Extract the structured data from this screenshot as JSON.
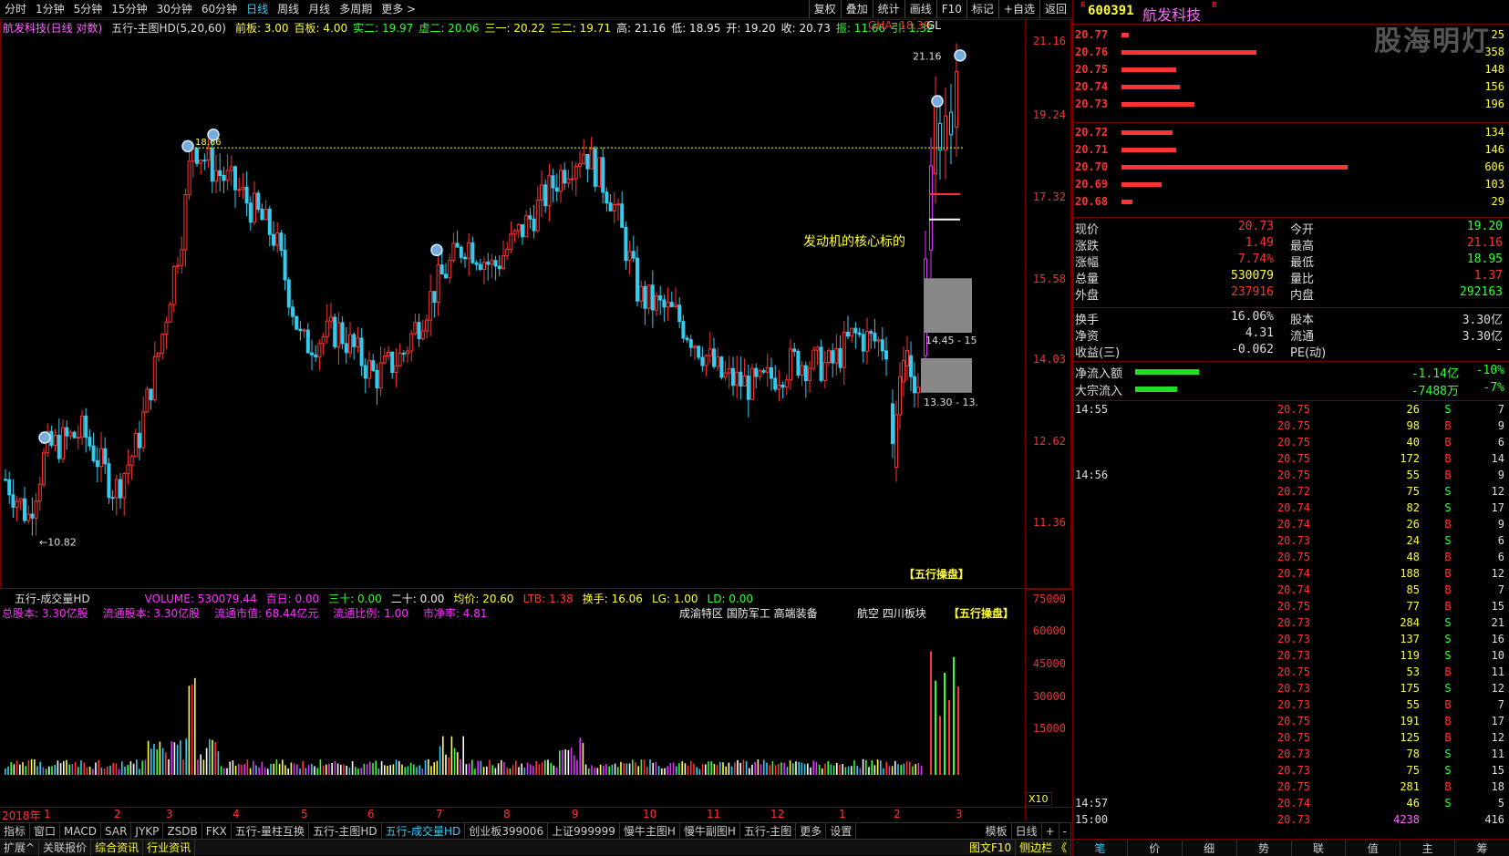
{
  "toolbar": {
    "periods": [
      "分时",
      "1分钟",
      "5分钟",
      "15分钟",
      "30分钟",
      "60分钟",
      "日线",
      "周线",
      "月线",
      "多周期",
      "更多 >"
    ],
    "active": "日线",
    "right_buttons": [
      "复权",
      "叠加",
      "统计",
      "画线",
      "F10",
      "标记",
      "+自选",
      "返回"
    ]
  },
  "main_info": {
    "name": "航发科技",
    "mode": "(日线 对数)",
    "indicator": "五行-主图HD(5,20,60)",
    "items": [
      {
        "k": "前板:",
        "v": "3.00",
        "c": "#ff3"
      },
      {
        "k": "百板:",
        "v": "4.00",
        "c": "#ff3"
      },
      {
        "k": "实二:",
        "v": "19.97",
        "c": "#3f3"
      },
      {
        "k": "虚二:",
        "v": "20.06",
        "c": "#3f3"
      },
      {
        "k": "三一:",
        "v": "20.22",
        "c": "#ff3"
      },
      {
        "k": "三二:",
        "v": "19.71",
        "c": "#ff3"
      },
      {
        "k": "高:",
        "v": "21.16",
        "c": "#eee"
      },
      {
        "k": "低:",
        "v": "18.95",
        "c": "#eee"
      },
      {
        "k": "开:",
        "v": "19.20",
        "c": "#eee"
      },
      {
        "k": "收:",
        "v": "20.73",
        "c": "#eee"
      },
      {
        "k": "振:",
        "v": "11.66",
        "c": "#3f3"
      },
      {
        "k": "引:",
        "v": "1.32",
        "c": "#3f3"
      }
    ],
    "gha": "GHA: 18.39",
    "gl": "GL"
  },
  "price_axis": [
    "21.16",
    "19.24",
    "17.32",
    "15.58",
    "14.03",
    "12.62",
    "11.36"
  ],
  "chart_labels": {
    "high_mark": "21.16",
    "low_mark": "10.82",
    "level_mark": "18.66",
    "annotation": "发动机的核心标的",
    "box1": "14.45 - 15",
    "box2": "13.30 - 13.",
    "brand": "【五行操盘】"
  },
  "vol_info": {
    "title": "五行-成交量HD",
    "items": [
      {
        "k": "VOLUME:",
        "v": "530079.44",
        "c": "#f3f"
      },
      {
        "k": "百日:",
        "v": "0.00",
        "c": "#f3f"
      },
      {
        "k": "三十:",
        "v": "0.00",
        "c": "#3f3"
      },
      {
        "k": "二十:",
        "v": "0.00",
        "c": "#eee"
      },
      {
        "k": "均价:",
        "v": "20.60",
        "c": "#ff3"
      },
      {
        "k": "LTB:",
        "v": "1.38",
        "c": "#f33"
      },
      {
        "k": "换手:",
        "v": "16.06",
        "c": "#ff3"
      },
      {
        "k": "LG:",
        "v": "1.00",
        "c": "#ff3"
      },
      {
        "k": "LD:",
        "v": "0.00",
        "c": "#3f3"
      }
    ],
    "line2": [
      {
        "k": "总股本:",
        "v": "3.30亿股"
      },
      {
        "k": "流通股本:",
        "v": "3.30亿股"
      },
      {
        "k": "流通市值:",
        "v": "68.44亿元"
      },
      {
        "k": "流通比例:",
        "v": "1.00"
      },
      {
        "k": "市净率:",
        "v": "4.81"
      }
    ],
    "tags": "成渝特区 国防军工 高端装备",
    "tags2": "航空  四川板块",
    "brand": "【五行操盘】",
    "axis": [
      "75000",
      "60000",
      "45000",
      "30000",
      "15000"
    ],
    "x10": "X10"
  },
  "x_axis": {
    "year": "2018年",
    "months": [
      "1",
      "2",
      "3",
      "4",
      "5",
      "6",
      "7",
      "8",
      "9",
      "10",
      "11",
      "12",
      "1",
      "2",
      "3"
    ]
  },
  "bottom_tabs": [
    "指标",
    "窗口",
    "MACD",
    "SAR",
    "JYKP",
    "ZSDB",
    "FKX",
    "五行-量柱互换",
    "五行-主图HD",
    "五行-成交量HD",
    "创业板399006",
    "上证999999",
    "慢牛主图H",
    "慢牛副图H",
    "五行-主图",
    "更多",
    "设置"
  ],
  "bottom_tabs_active": "五行-成交量HD",
  "bottom_right": [
    "模板",
    "日线",
    "+",
    "-"
  ],
  "status_bar": [
    "扩展^",
    "关联报价",
    "综合资讯",
    "行业资讯"
  ],
  "status_right": [
    "图文F10",
    "侧边栏 《"
  ],
  "right": {
    "code": "600391",
    "name": "航发科技",
    "watermark": "股海明灯",
    "asks": [
      {
        "p": "20.77",
        "q": "25",
        "w": 2
      },
      {
        "p": "20.76",
        "q": "358",
        "w": 37
      },
      {
        "p": "20.75",
        "q": "148",
        "w": 15
      },
      {
        "p": "20.74",
        "q": "156",
        "w": 16
      },
      {
        "p": "20.73",
        "q": "196",
        "w": 20
      }
    ],
    "bids": [
      {
        "p": "20.72",
        "q": "134",
        "w": 14
      },
      {
        "p": "20.71",
        "q": "146",
        "w": 15
      },
      {
        "p": "20.70",
        "q": "606",
        "w": 62
      },
      {
        "p": "20.69",
        "q": "103",
        "w": 11
      },
      {
        "p": "20.68",
        "q": "29",
        "w": 3
      }
    ],
    "quotes": [
      {
        "k1": "现价",
        "v1": "20.73",
        "c1": "#f33",
        "k2": "今开",
        "v2": "19.20",
        "c2": "#3f3"
      },
      {
        "k1": "涨跌",
        "v1": "1.49",
        "c1": "#f33",
        "k2": "最高",
        "v2": "21.16",
        "c2": "#f33"
      },
      {
        "k1": "涨幅",
        "v1": "7.74%",
        "c1": "#f33",
        "k2": "最低",
        "v2": "18.95",
        "c2": "#3f3"
      },
      {
        "k1": "总量",
        "v1": "530079",
        "c1": "#ff3",
        "k2": "量比",
        "v2": "1.37",
        "c2": "#f33"
      },
      {
        "k1": "外盘",
        "v1": "237916",
        "c1": "#f33",
        "k2": "内盘",
        "v2": "292163",
        "c2": "#3f3"
      }
    ],
    "quotes2": [
      {
        "k1": "换手",
        "v1": "16.06%",
        "c1": "#ddd",
        "k2": "股本",
        "v2": "3.30亿",
        "c2": "#ddd"
      },
      {
        "k1": "净资",
        "v1": "4.31",
        "c1": "#ddd",
        "k2": "流通",
        "v2": "3.30亿",
        "c2": "#ddd"
      },
      {
        "k1": "收益(三)",
        "v1": "-0.062",
        "c1": "#ddd",
        "k2": "PE(动)",
        "v2": "-",
        "c2": "#ddd"
      }
    ],
    "flows": [
      {
        "k": "净流入额",
        "v": "-1.14亿",
        "pct": "-10%",
        "w": 70
      },
      {
        "k": "大宗流入",
        "v": "-7488万",
        "pct": "-7%",
        "w": 46
      }
    ],
    "ticks": [
      {
        "t": "14:55",
        "p": "20.75",
        "v": "26",
        "bs": "S",
        "n": "7"
      },
      {
        "t": "",
        "p": "20.75",
        "v": "98",
        "bs": "B",
        "n": "9"
      },
      {
        "t": "",
        "p": "20.75",
        "v": "40",
        "bs": "B",
        "n": "6"
      },
      {
        "t": "",
        "p": "20.75",
        "v": "172",
        "bs": "B",
        "n": "14"
      },
      {
        "t": "14:56",
        "p": "20.75",
        "v": "55",
        "bs": "B",
        "n": "9"
      },
      {
        "t": "",
        "p": "20.72",
        "v": "75",
        "bs": "S",
        "n": "12"
      },
      {
        "t": "",
        "p": "20.74",
        "v": "82",
        "bs": "S",
        "n": "17"
      },
      {
        "t": "",
        "p": "20.74",
        "v": "26",
        "bs": "B",
        "n": "9"
      },
      {
        "t": "",
        "p": "20.73",
        "v": "24",
        "bs": "S",
        "n": "6"
      },
      {
        "t": "",
        "p": "20.75",
        "v": "48",
        "bs": "B",
        "n": "6"
      },
      {
        "t": "",
        "p": "20.74",
        "v": "188",
        "bs": "B",
        "n": "12"
      },
      {
        "t": "",
        "p": "20.74",
        "v": "85",
        "bs": "B",
        "n": "7"
      },
      {
        "t": "",
        "p": "20.75",
        "v": "77",
        "bs": "B",
        "n": "15"
      },
      {
        "t": "",
        "p": "20.73",
        "v": "284",
        "bs": "S",
        "n": "21"
      },
      {
        "t": "",
        "p": "20.73",
        "v": "137",
        "bs": "S",
        "n": "16"
      },
      {
        "t": "",
        "p": "20.73",
        "v": "119",
        "bs": "S",
        "n": "10"
      },
      {
        "t": "",
        "p": "20.75",
        "v": "53",
        "bs": "B",
        "n": "11"
      },
      {
        "t": "",
        "p": "20.73",
        "v": "175",
        "bs": "S",
        "n": "12"
      },
      {
        "t": "",
        "p": "20.73",
        "v": "55",
        "bs": "B",
        "n": "7"
      },
      {
        "t": "",
        "p": "20.75",
        "v": "191",
        "bs": "B",
        "n": "17"
      },
      {
        "t": "",
        "p": "20.75",
        "v": "125",
        "bs": "B",
        "n": "12"
      },
      {
        "t": "",
        "p": "20.73",
        "v": "78",
        "bs": "S",
        "n": "11"
      },
      {
        "t": "",
        "p": "20.73",
        "v": "75",
        "bs": "S",
        "n": "15"
      },
      {
        "t": "",
        "p": "20.75",
        "v": "281",
        "bs": "B",
        "n": "18"
      },
      {
        "t": "14:57",
        "p": "20.74",
        "v": "46",
        "bs": "S",
        "n": "5"
      },
      {
        "t": "15:00",
        "p": "20.73",
        "v": "4238",
        "bs": "",
        "n": "416"
      }
    ],
    "bottom_tabs": [
      "笔",
      "价",
      "细",
      "势",
      "联",
      "值",
      "主",
      "筹"
    ]
  },
  "colors": {
    "up": "#ff3333",
    "down": "#33ccee",
    "accent": "#3cf",
    "grid": "#7a0000"
  }
}
